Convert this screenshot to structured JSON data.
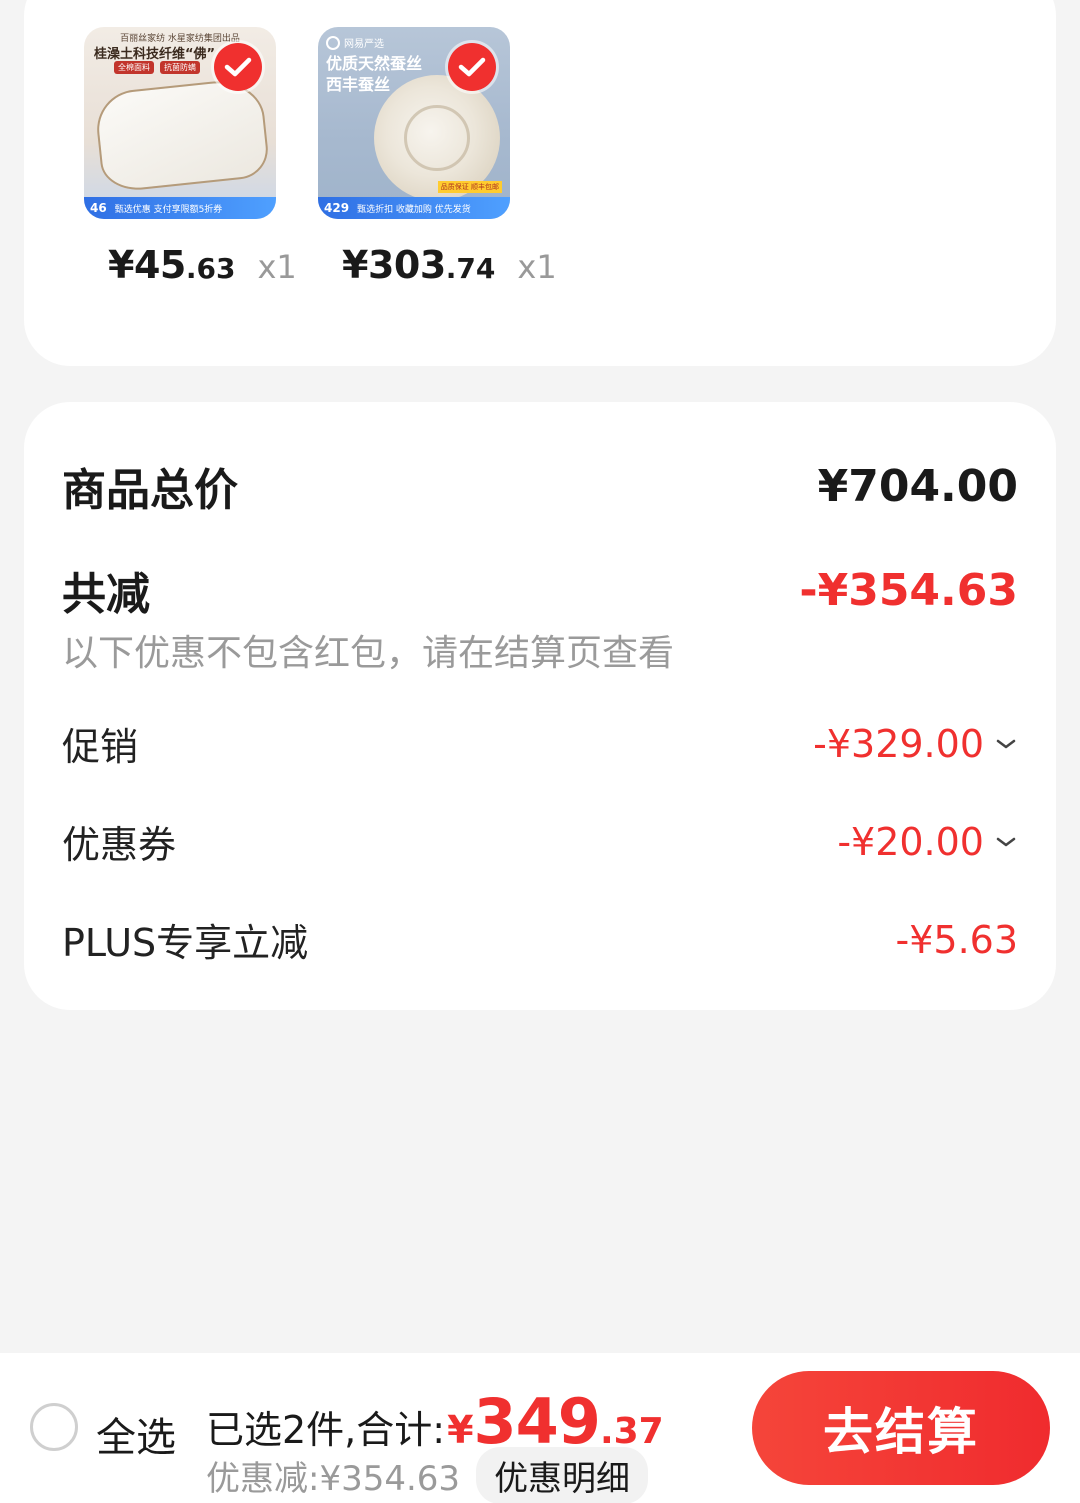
{
  "products": [
    {
      "name": "pillow",
      "thumb": {
        "brand": "百丽丝家纺  水星家纺集团出品",
        "headline": "桂澡土科技纤维“佛”",
        "tags": [
          "全棉面料",
          "抗菌防螨"
        ],
        "promo_price": "46",
        "promo_text": "甄选优惠 支付享限额5折券"
      },
      "price_int": "¥45",
      "price_dec": ".63",
      "qty": "x1",
      "selected": true
    },
    {
      "name": "silk-quilt",
      "thumb": {
        "brand": "网易严选",
        "headline_line1": "优质天然蚕丝",
        "headline_line2": "西丰蚕丝",
        "sub_tag": "品质保证 顺丰包邮",
        "promo_price": "429",
        "promo_text": "甄选折扣 收藏加购 优先发货"
      },
      "price_int": "¥303",
      "price_dec": ".74",
      "qty": "x1",
      "selected": true
    }
  ],
  "summary": {
    "total_label": "商品总价",
    "total_value": "¥704.00",
    "reduce_label": "共减",
    "reduce_value": "-¥354.63",
    "note": "以下优惠不包含红包，请在结算页查看",
    "promo_label": "促销",
    "promo_value": "-¥329.00",
    "coupon_label": "优惠券",
    "coupon_value": "-¥20.00",
    "plus_label": "PLUS专享立减",
    "plus_value": "-¥5.63"
  },
  "footer": {
    "select_all": "全选",
    "selected_text": "已选2件,合计:",
    "yen": "¥",
    "total_int": "349",
    "total_dec": ".37",
    "discount_text": "优惠减:¥354.63",
    "detail_button": "优惠明细",
    "checkout_button": "去结算"
  },
  "colors": {
    "accent": "#f0302f",
    "background": "#f4f4f4",
    "muted_text": "#9a9a9a"
  }
}
